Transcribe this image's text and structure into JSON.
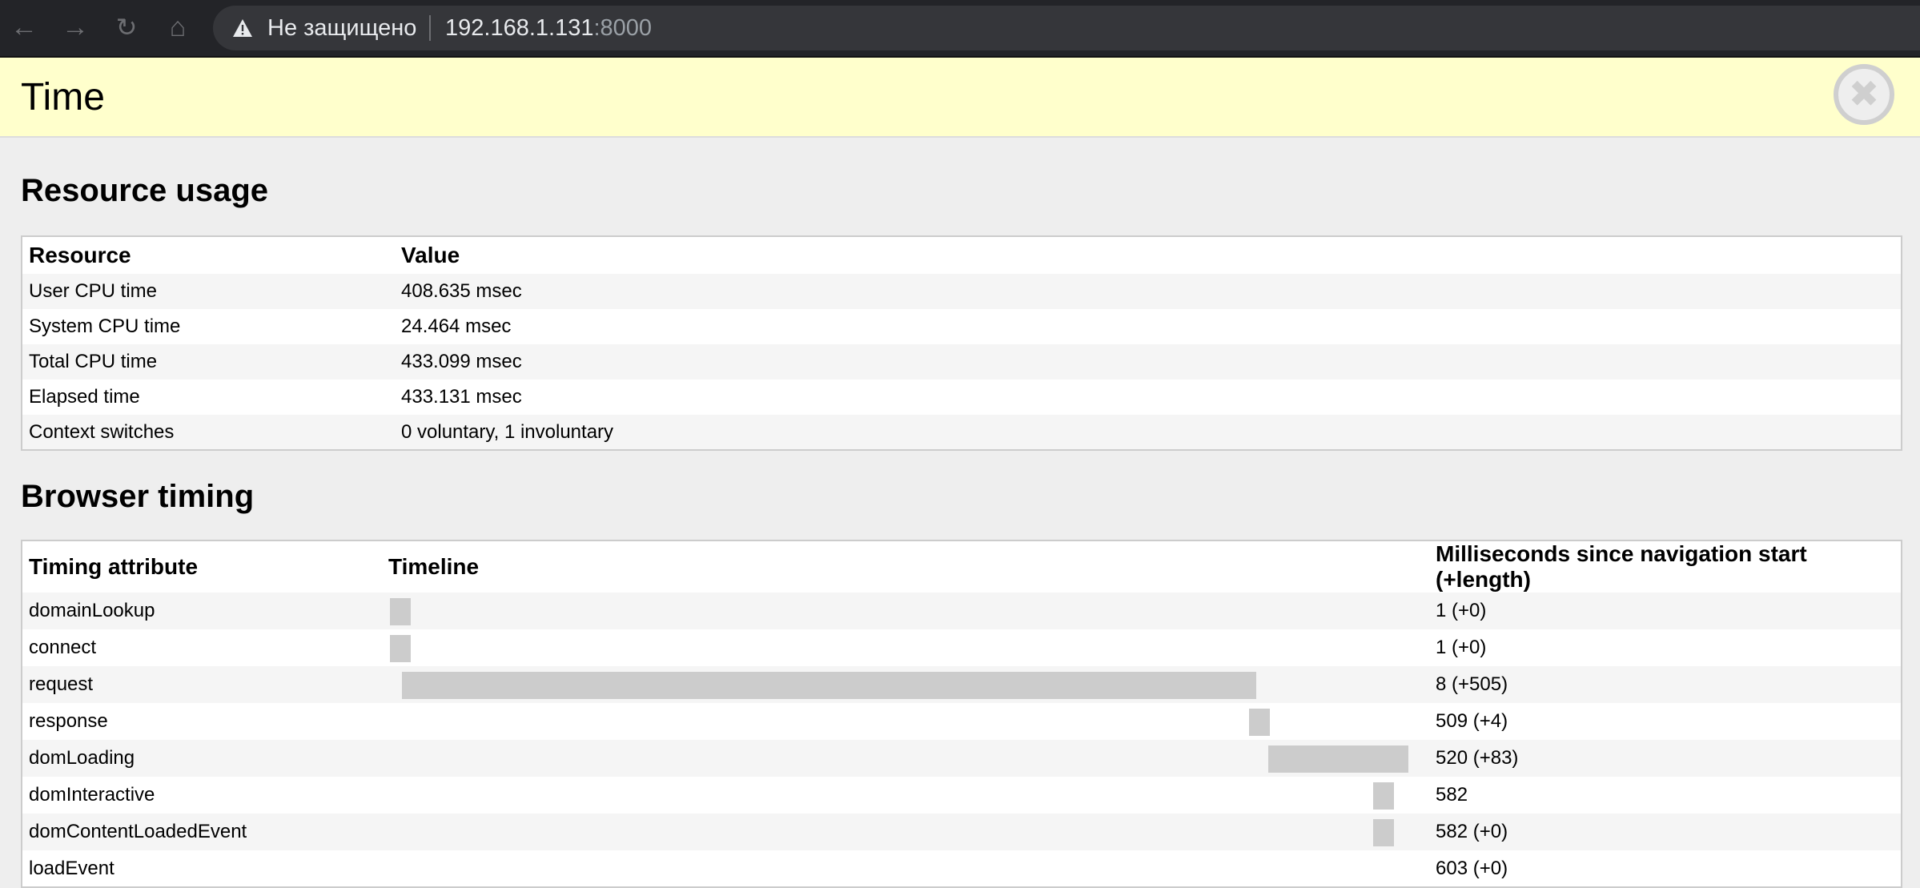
{
  "browser": {
    "security_label": "Не защищено",
    "url_host": "192.168.1.131",
    "url_port": ":8000"
  },
  "panel": {
    "title": "Time",
    "close_label": "✖"
  },
  "resource_usage": {
    "heading": "Resource usage",
    "columns": [
      "Resource",
      "Value"
    ],
    "rows": [
      {
        "resource": "User CPU time",
        "value": "408.635 msec"
      },
      {
        "resource": "System CPU time",
        "value": "24.464 msec"
      },
      {
        "resource": "Total CPU time",
        "value": "433.099 msec"
      },
      {
        "resource": "Elapsed time",
        "value": "433.131 msec"
      },
      {
        "resource": "Context switches",
        "value": "0 voluntary, 1 involuntary"
      }
    ]
  },
  "browser_timing": {
    "heading": "Browser timing",
    "columns": [
      "Timing attribute",
      "Timeline",
      "Milliseconds since navigation start (+length)"
    ],
    "total_ms": 603,
    "rows": [
      {
        "attribute": "domainLookup",
        "start": 1,
        "length": 0,
        "label": "1 (+0)"
      },
      {
        "attribute": "connect",
        "start": 1,
        "length": 0,
        "label": "1 (+0)"
      },
      {
        "attribute": "request",
        "start": 8,
        "length": 505,
        "label": "8 (+505)"
      },
      {
        "attribute": "response",
        "start": 509,
        "length": 4,
        "label": "509 (+4)"
      },
      {
        "attribute": "domLoading",
        "start": 520,
        "length": 83,
        "label": "520 (+83)"
      },
      {
        "attribute": "domInteractive",
        "start": 582,
        "length": 0,
        "label": "582"
      },
      {
        "attribute": "domContentLoadedEvent",
        "start": 582,
        "length": 0,
        "label": "582 (+0)"
      },
      {
        "attribute": "loadEvent",
        "start": 603,
        "length": 0,
        "label": "603 (+0)",
        "no_bar": true
      }
    ]
  }
}
